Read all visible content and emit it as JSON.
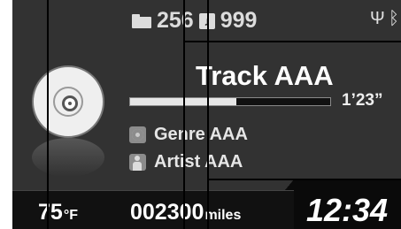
{
  "status": {
    "folder_count": "256",
    "track_count": "999",
    "usb_icon": "usb-icon",
    "bluetooth_icon": "bluetooth-icon"
  },
  "track": {
    "title": "Track AAA",
    "elapsed": "1’23”",
    "progress_fraction": 0.53
  },
  "info": {
    "genre": "Genre AAA",
    "artist": "Artist AAA"
  },
  "bottom": {
    "temperature": "75",
    "temperature_unit": "°F",
    "odometer": "002300",
    "odometer_unit": "miles",
    "clock": "12:34"
  },
  "colors": {
    "background": "#323232",
    "bar": "#111111",
    "text": "#ffffff"
  }
}
